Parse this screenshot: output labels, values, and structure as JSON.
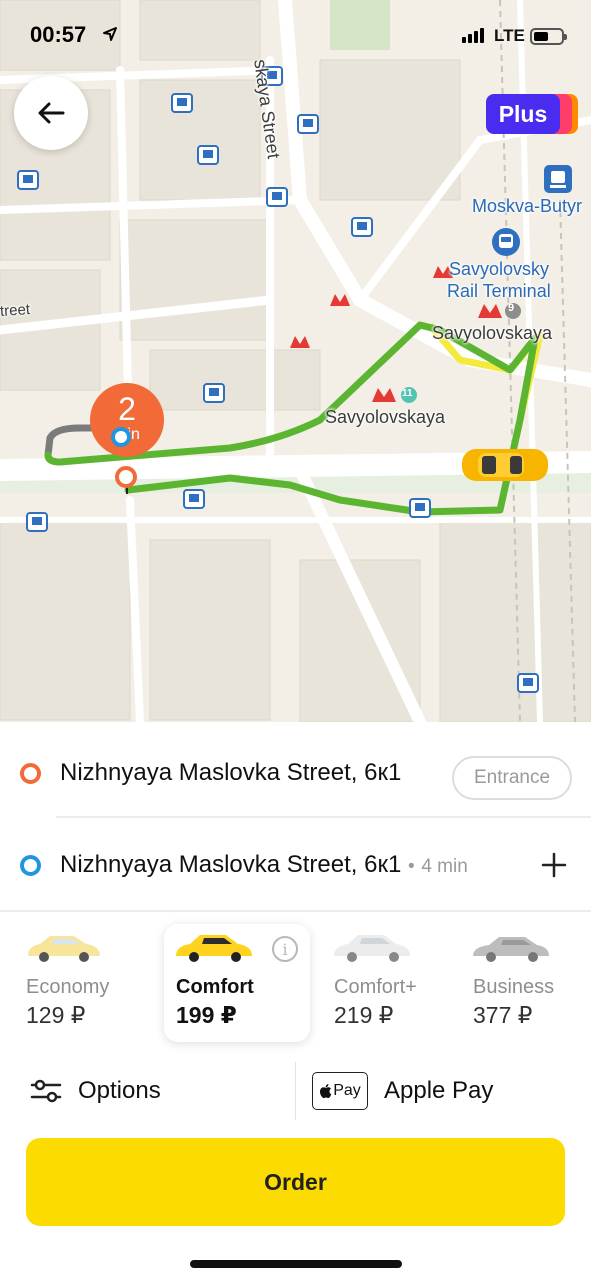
{
  "status_bar": {
    "time": "00:57",
    "network": "LTE"
  },
  "map": {
    "labels": {
      "street_vertical": "skaya Street",
      "street_left": "treet",
      "moskva_butyr": "Moskva-Butyr",
      "rail_terminal_line1": "Savyolovsky",
      "rail_terminal_line2": "Rail Terminal",
      "metro_9": "Savyolovskaya",
      "metro_11": "Savyolovskaya"
    },
    "metro_line_numbers": {
      "line9": "9",
      "line11": "11"
    },
    "eta": {
      "value": "2",
      "unit": "min"
    },
    "route_colors": {
      "main": "#5cb531",
      "alt": "#f4ea3f",
      "pickup_marker": "#f26a38",
      "dest_marker": "#2196e0"
    }
  },
  "plus_badge": {
    "label": "Plus"
  },
  "route": {
    "from": {
      "address": "Nizhnyaya Maslovka Street, 6к1",
      "entrance_label": "Entrance"
    },
    "to": {
      "address": "Nizhnyaya Maslovka Street, 6к1",
      "duration": "4 min",
      "separator": "•"
    }
  },
  "tariffs": [
    {
      "name": "Economy",
      "price": "129 ₽",
      "car_color": "#f6e59a",
      "selected": false
    },
    {
      "name": "Comfort",
      "price": "199 ₽",
      "car_color": "#ffd21f",
      "selected": true
    },
    {
      "name": "Comfort+",
      "price": "219 ₽",
      "car_color": "#ececec",
      "selected": false
    },
    {
      "name": "Business",
      "price": "377 ₽",
      "car_color": "#bdbdbd",
      "selected": false
    }
  ],
  "options": {
    "label": "Options"
  },
  "payment": {
    "badge": "Pay",
    "label": "Apple Pay"
  },
  "order_button": {
    "label": "Order"
  },
  "colors": {
    "accent_yellow": "#fcdb00",
    "plus_purple": "#4a2cf0"
  }
}
